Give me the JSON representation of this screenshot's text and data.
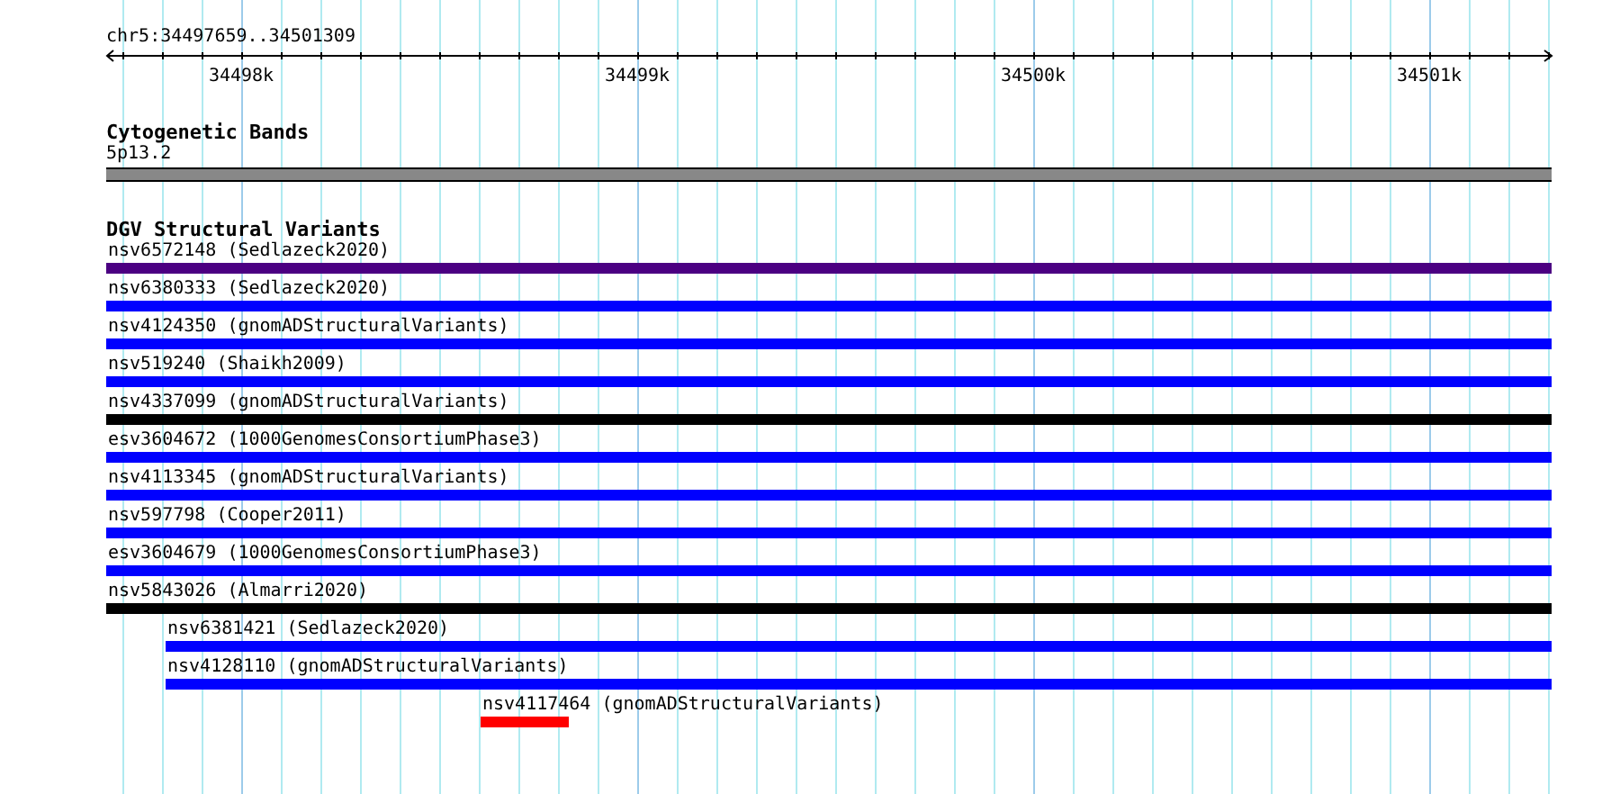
{
  "ruler": {
    "position": "chr5:34497659..34501309",
    "ticks": [
      "34498k",
      "34499k",
      "34500k",
      "34501k"
    ]
  },
  "cytogenetic_bands": {
    "title": "Cytogenetic Bands",
    "bands": [
      {
        "label": "5p13.2",
        "color": "#888888"
      }
    ]
  },
  "dgv_structural_variants": {
    "title": "DGV Structural Variants",
    "features": [
      {
        "label": "nsv6572148 (Sedlazeck2020)",
        "color": "#4b0082"
      },
      {
        "label": "nsv6380333 (Sedlazeck2020)",
        "color": "#0000ff"
      },
      {
        "label": "nsv4124350 (gnomADStructuralVariants)",
        "color": "#0000ff"
      },
      {
        "label": "nsv519240 (Shaikh2009)",
        "color": "#0000ff"
      },
      {
        "label": "nsv4337099 (gnomADStructuralVariants)",
        "color": "#000000"
      },
      {
        "label": "esv3604672 (1000GenomesConsortiumPhase3)",
        "color": "#0000ff"
      },
      {
        "label": "nsv4113345 (gnomADStructuralVariants)",
        "color": "#0000ff"
      },
      {
        "label": "nsv597798 (Cooper2011)",
        "color": "#0000ff"
      },
      {
        "label": "esv3604679 (1000GenomesConsortiumPhase3)",
        "color": "#0000ff"
      },
      {
        "label": "nsv5843026 (Almarri2020)",
        "color": "#000000"
      },
      {
        "label": "nsv6381421 (Sedlazeck2020)",
        "color": "#0000ff"
      },
      {
        "label": "nsv4128110 (gnomADStructuralVariants)",
        "color": "#0000ff"
      },
      {
        "label": "nsv4117464 (gnomADStructuralVariants)",
        "color": "#ff0000"
      }
    ]
  }
}
